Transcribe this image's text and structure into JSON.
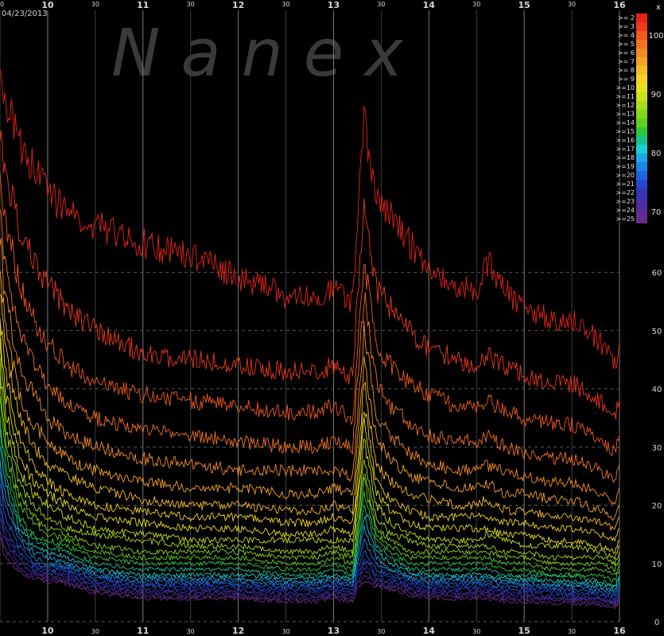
{
  "watermark": "N a n e x",
  "date": "04/23/2013",
  "chart_data": {
    "type": "line",
    "x_range": [
      9.5,
      16.0
    ],
    "y_range": [
      0,
      105
    ],
    "y_ticks": [
      0,
      10,
      20,
      30,
      40,
      50,
      60
    ],
    "x_hour_ticks": [
      {
        "x": 10,
        "label": "10"
      },
      {
        "x": 11,
        "label": "11"
      },
      {
        "x": 12,
        "label": "12"
      },
      {
        "x": 13,
        "label": "13"
      },
      {
        "x": 14,
        "label": "14"
      },
      {
        "x": 15,
        "label": "15"
      },
      {
        "x": 16,
        "label": "16"
      }
    ],
    "x_half_ticks": [
      {
        "x": 9.5,
        "label": "30"
      },
      {
        "x": 10.5,
        "label": "30"
      },
      {
        "x": 11.5,
        "label": "30"
      },
      {
        "x": 12.5,
        "label": "30"
      },
      {
        "x": 13.5,
        "label": "30"
      },
      {
        "x": 14.5,
        "label": "30"
      },
      {
        "x": 15.5,
        "label": "30"
      }
    ],
    "x_axis_labels_top": true,
    "x_axis_labels_bottom": true,
    "grid": true,
    "legend_position": "top-right",
    "colorbar": {
      "label": "x",
      "ticks": [
        "100",
        "90",
        "80",
        "70"
      ]
    },
    "series_x": [
      9.5,
      9.55,
      9.7,
      9.85,
      10.0,
      10.2,
      10.5,
      11.0,
      11.5,
      12.0,
      12.5,
      12.8,
      13.0,
      13.2,
      13.25,
      13.32,
      13.45,
      13.6,
      13.8,
      14.0,
      14.3,
      14.5,
      14.6,
      14.8,
      15.0,
      15.3,
      15.5,
      15.8,
      15.95,
      16.0
    ],
    "series": [
      {
        "name": ">= 2",
        "color": "#e8221a",
        "values": [
          95,
          90,
          82,
          78,
          74,
          70,
          68,
          65,
          63,
          59,
          56,
          56,
          57,
          55,
          70,
          86,
          72,
          70,
          65,
          60,
          57,
          57,
          62,
          57,
          54,
          52,
          52,
          48,
          44,
          48
        ]
      },
      {
        "name": ">= 3",
        "color": "#ef3a1c",
        "values": [
          83,
          78,
          68,
          62,
          58,
          54,
          50,
          46,
          45,
          44,
          43,
          43,
          44,
          42,
          56,
          72,
          57,
          54,
          50,
          47,
          45,
          44,
          46,
          44,
          42,
          41,
          41,
          38,
          35,
          38
        ]
      },
      {
        "name": ">= 4",
        "color": "#f25a1e",
        "values": [
          78,
          70,
          58,
          52,
          48,
          44,
          41,
          39,
          38,
          37,
          36,
          36,
          37,
          35,
          47,
          62,
          48,
          44,
          41,
          39,
          37,
          37,
          38,
          36,
          35,
          34,
          34,
          31,
          29,
          32
        ]
      },
      {
        "name": ">= 5",
        "color": "#f47322",
        "values": [
          72,
          62,
          50,
          45,
          41,
          37,
          35,
          33,
          32,
          31,
          30,
          30,
          31,
          30,
          41,
          56,
          41,
          37,
          34,
          32,
          31,
          31,
          32,
          30,
          29,
          28,
          28,
          26,
          24,
          27
        ]
      },
      {
        "name": ">= 6",
        "color": "#f68c24",
        "values": [
          66,
          56,
          44,
          39,
          35,
          32,
          30,
          28,
          27,
          26,
          26,
          26,
          26,
          25,
          35,
          50,
          35,
          32,
          29,
          27,
          26,
          26,
          27,
          26,
          25,
          24,
          24,
          22,
          20,
          23
        ]
      },
      {
        "name": ">= 7",
        "color": "#f7a326",
        "values": [
          62,
          51,
          39,
          34,
          31,
          28,
          26,
          24,
          23,
          23,
          22,
          22,
          23,
          22,
          31,
          45,
          31,
          28,
          25,
          24,
          23,
          23,
          24,
          22,
          22,
          21,
          21,
          19,
          18,
          20
        ]
      },
      {
        "name": ">= 8",
        "color": "#f7bd26",
        "values": [
          58,
          47,
          35,
          30,
          27,
          25,
          23,
          21,
          20,
          20,
          19,
          19,
          20,
          19,
          27,
          41,
          27,
          24,
          22,
          21,
          20,
          20,
          21,
          19,
          19,
          18,
          18,
          17,
          16,
          18
        ]
      },
      {
        "name": ">= 9",
        "color": "#f3d424",
        "values": [
          54,
          43,
          32,
          27,
          24,
          22,
          20,
          19,
          18,
          18,
          17,
          17,
          18,
          17,
          24,
          37,
          24,
          21,
          19,
          18,
          18,
          18,
          18,
          17,
          17,
          16,
          16,
          15,
          14,
          16
        ]
      },
      {
        "name": ">=10",
        "color": "#e4e21c",
        "values": [
          50,
          40,
          29,
          24,
          22,
          20,
          18,
          17,
          16,
          16,
          15,
          15,
          16,
          15,
          22,
          34,
          22,
          19,
          17,
          16,
          16,
          16,
          16,
          15,
          15,
          14,
          14,
          13,
          12,
          14
        ]
      },
      {
        "name": ">=11",
        "color": "#c8e01c",
        "values": [
          47,
          37,
          26,
          22,
          20,
          18,
          16,
          15,
          14,
          14,
          14,
          14,
          14,
          14,
          20,
          31,
          20,
          17,
          15,
          14,
          14,
          14,
          15,
          14,
          13,
          13,
          13,
          12,
          11,
          13
        ]
      },
      {
        "name": ">=12",
        "color": "#a8dc1c",
        "values": [
          44,
          34,
          24,
          20,
          18,
          16,
          15,
          14,
          13,
          13,
          12,
          12,
          13,
          12,
          18,
          28,
          18,
          15,
          14,
          13,
          13,
          13,
          13,
          12,
          12,
          11,
          11,
          11,
          10,
          12
        ]
      },
      {
        "name": ">=13",
        "color": "#86d61c",
        "values": [
          41,
          32,
          22,
          18,
          16,
          15,
          13,
          12,
          12,
          12,
          11,
          11,
          12,
          11,
          16,
          26,
          16,
          14,
          12,
          12,
          12,
          12,
          12,
          11,
          11,
          10,
          10,
          10,
          9,
          11
        ]
      },
      {
        "name": ">=14",
        "color": "#5ccf20",
        "values": [
          38,
          30,
          20,
          17,
          15,
          14,
          12,
          11,
          11,
          11,
          10,
          10,
          11,
          10,
          15,
          24,
          15,
          13,
          11,
          11,
          11,
          11,
          11,
          10,
          10,
          9,
          9,
          9,
          8,
          10
        ]
      },
      {
        "name": ">=15",
        "color": "#2fc83a",
        "values": [
          35,
          28,
          18,
          15,
          14,
          13,
          11,
          10,
          10,
          10,
          9,
          9,
          10,
          9,
          14,
          22,
          14,
          12,
          10,
          10,
          10,
          10,
          10,
          9,
          9,
          8,
          8,
          8,
          7,
          9
        ]
      },
      {
        "name": ">=16",
        "color": "#18c48a",
        "values": [
          33,
          26,
          17,
          14,
          13,
          12,
          10,
          9,
          9,
          9,
          8,
          8,
          9,
          8,
          13,
          20,
          13,
          11,
          9,
          9,
          9,
          9,
          9,
          8,
          8,
          8,
          8,
          7,
          6,
          8
        ]
      },
      {
        "name": ">=17",
        "color": "#18d0d0",
        "values": [
          30,
          24,
          16,
          13,
          12,
          11,
          9,
          8,
          8,
          8,
          7.5,
          7.5,
          8,
          7.5,
          12,
          18,
          12,
          10,
          8.5,
          8,
          8,
          8,
          8,
          7.5,
          7.5,
          7,
          7,
          6.5,
          6,
          7.5
        ]
      },
      {
        "name": ">=18",
        "color": "#1aa8e8",
        "values": [
          28,
          22,
          15,
          12,
          11,
          10,
          8.5,
          7.5,
          7.5,
          7.5,
          7,
          7,
          7.5,
          7,
          11,
          16,
          11,
          9,
          8,
          7.5,
          7.5,
          7.5,
          7.5,
          7,
          7,
          6.5,
          6.5,
          6,
          5.5,
          7
        ]
      },
      {
        "name": ">=19",
        "color": "#1a86e8",
        "values": [
          26,
          20,
          14,
          11,
          10,
          9.5,
          8,
          7,
          7,
          7,
          6.5,
          6.5,
          7,
          6.5,
          10,
          14,
          10,
          8.5,
          7.5,
          7,
          7,
          7,
          7,
          6.5,
          6.5,
          6,
          6,
          5.5,
          5,
          6.5
        ]
      },
      {
        "name": ">=20",
        "color": "#1e64e0",
        "values": [
          24,
          18,
          13,
          10,
          9.5,
          9,
          7.5,
          6.5,
          6.5,
          6.5,
          6,
          6,
          6.5,
          6,
          9,
          12,
          9,
          8,
          7,
          6.5,
          6.5,
          6.5,
          6.5,
          6,
          6,
          5.5,
          5.5,
          5,
          4.5,
          6
        ]
      },
      {
        "name": ">=21",
        "color": "#2448d0",
        "values": [
          22,
          16,
          12,
          9.5,
          9,
          8.5,
          7,
          6,
          6,
          6,
          5.5,
          5.5,
          6,
          5.5,
          8,
          11,
          8,
          7.5,
          6.5,
          6,
          6,
          6,
          6,
          5.5,
          5.5,
          5,
          5,
          4.5,
          4,
          5.5
        ]
      },
      {
        "name": ">=22",
        "color": "#3434b8",
        "values": [
          20,
          15,
          11,
          9,
          8.5,
          8,
          6.5,
          5.5,
          5.5,
          5.5,
          5,
          5,
          5.5,
          5,
          7.5,
          10,
          7.5,
          7,
          6,
          5.5,
          5.5,
          5.5,
          5.5,
          5,
          5,
          4.5,
          4.5,
          4,
          3.5,
          5
        ]
      },
      {
        "name": ">=23",
        "color": "#4630a8",
        "values": [
          18,
          14,
          10,
          8.5,
          8,
          7.5,
          6,
          5,
          5,
          5,
          4.5,
          4.5,
          5,
          4.5,
          7,
          9,
          7,
          6.5,
          5.5,
          5,
          5,
          5,
          5,
          4.5,
          4.5,
          4,
          4,
          3.8,
          3.2,
          4.5
        ]
      },
      {
        "name": ">=24",
        "color": "#582c98",
        "values": [
          16,
          12.5,
          9,
          8,
          7.5,
          7,
          5.5,
          4.5,
          4.5,
          4.5,
          4,
          4,
          4.5,
          4,
          6.5,
          8,
          6.5,
          6,
          5,
          4.5,
          4.5,
          4.5,
          4.5,
          4,
          4,
          3.8,
          3.8,
          3.5,
          3,
          4
        ]
      },
      {
        "name": ">=25",
        "color": "#6a2c8c",
        "values": [
          15,
          11,
          8.5,
          7.5,
          7,
          6.5,
          5,
          4,
          4,
          4,
          3.5,
          3.5,
          4,
          3.5,
          6,
          7,
          6,
          5.5,
          4.5,
          4,
          4,
          4,
          4,
          3.5,
          3.5,
          3.2,
          3.2,
          3,
          2.5,
          3.5
        ]
      }
    ]
  }
}
